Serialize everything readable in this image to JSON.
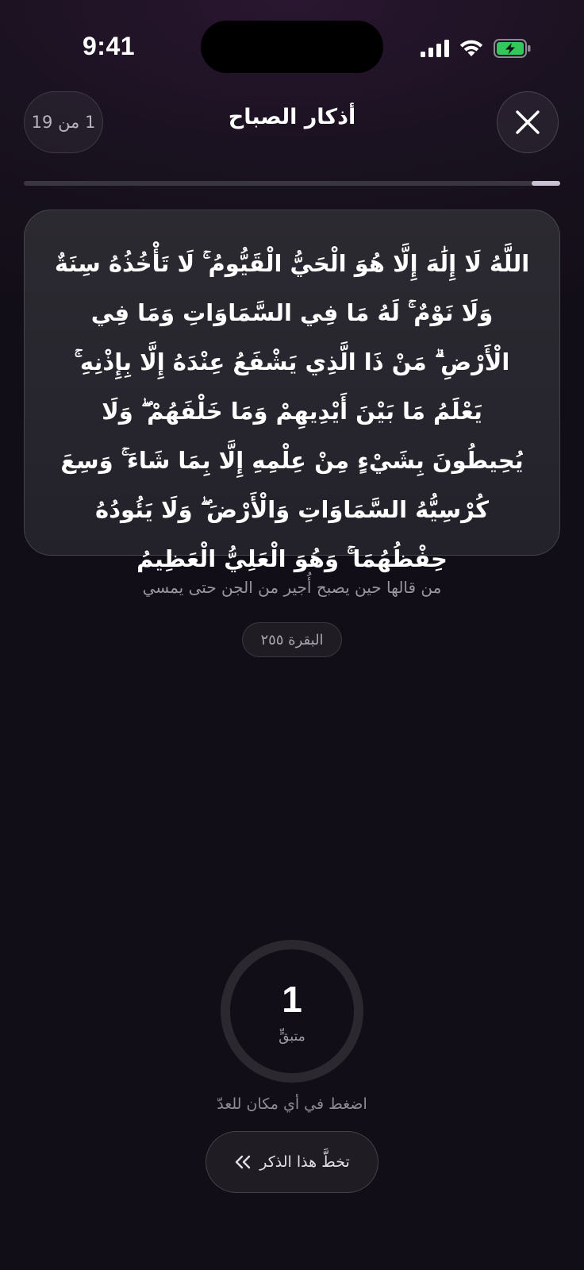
{
  "status_bar": {
    "time": "9:41",
    "battery_color": "#34c759"
  },
  "header": {
    "title": "أذكار الصباح",
    "counter": "1 من 19"
  },
  "progress": {
    "current": 1,
    "total": 19
  },
  "dhikr": {
    "text": "اللَّهُ لَا إِلَٰهَ إِلَّا هُوَ الْحَيُّ الْقَيُّومُ ۚ لَا تَأْخُذُهُ سِنَةٌ وَلَا نَوْمٌ ۚ لَهُ مَا فِي السَّمَاوَاتِ وَمَا فِي الْأَرْضِ ۗ مَنْ ذَا الَّذِي يَشْفَعُ عِنْدَهُ إِلَّا بِإِذْنِهِ ۚ يَعْلَمُ مَا بَيْنَ أَيْدِيهِمْ وَمَا خَلْفَهُمْ ۖ وَلَا يُحِيطُونَ بِشَيْءٍ مِنْ عِلْمِهِ إِلَّا بِمَا شَاءَ ۚ وَسِعَ كُرْسِيُّهُ السَّمَاوَاتِ وَالْأَرْضَ ۖ وَلَا يَئُودُهُ حِفْظُهُمَا ۚ وَهُوَ الْعَلِيُّ الْعَظِيمُ",
    "virtue": "من قالها حين يصبح أُجير من الجن حتى يمسي",
    "source": "البقرة ٢٥٥"
  },
  "counter_ring": {
    "remaining": "1",
    "label": "متبقٍّ"
  },
  "hint": "اضغط في أي مكان للعدّ",
  "skip_button": {
    "label": "تخطَّ هذا الذكر"
  }
}
